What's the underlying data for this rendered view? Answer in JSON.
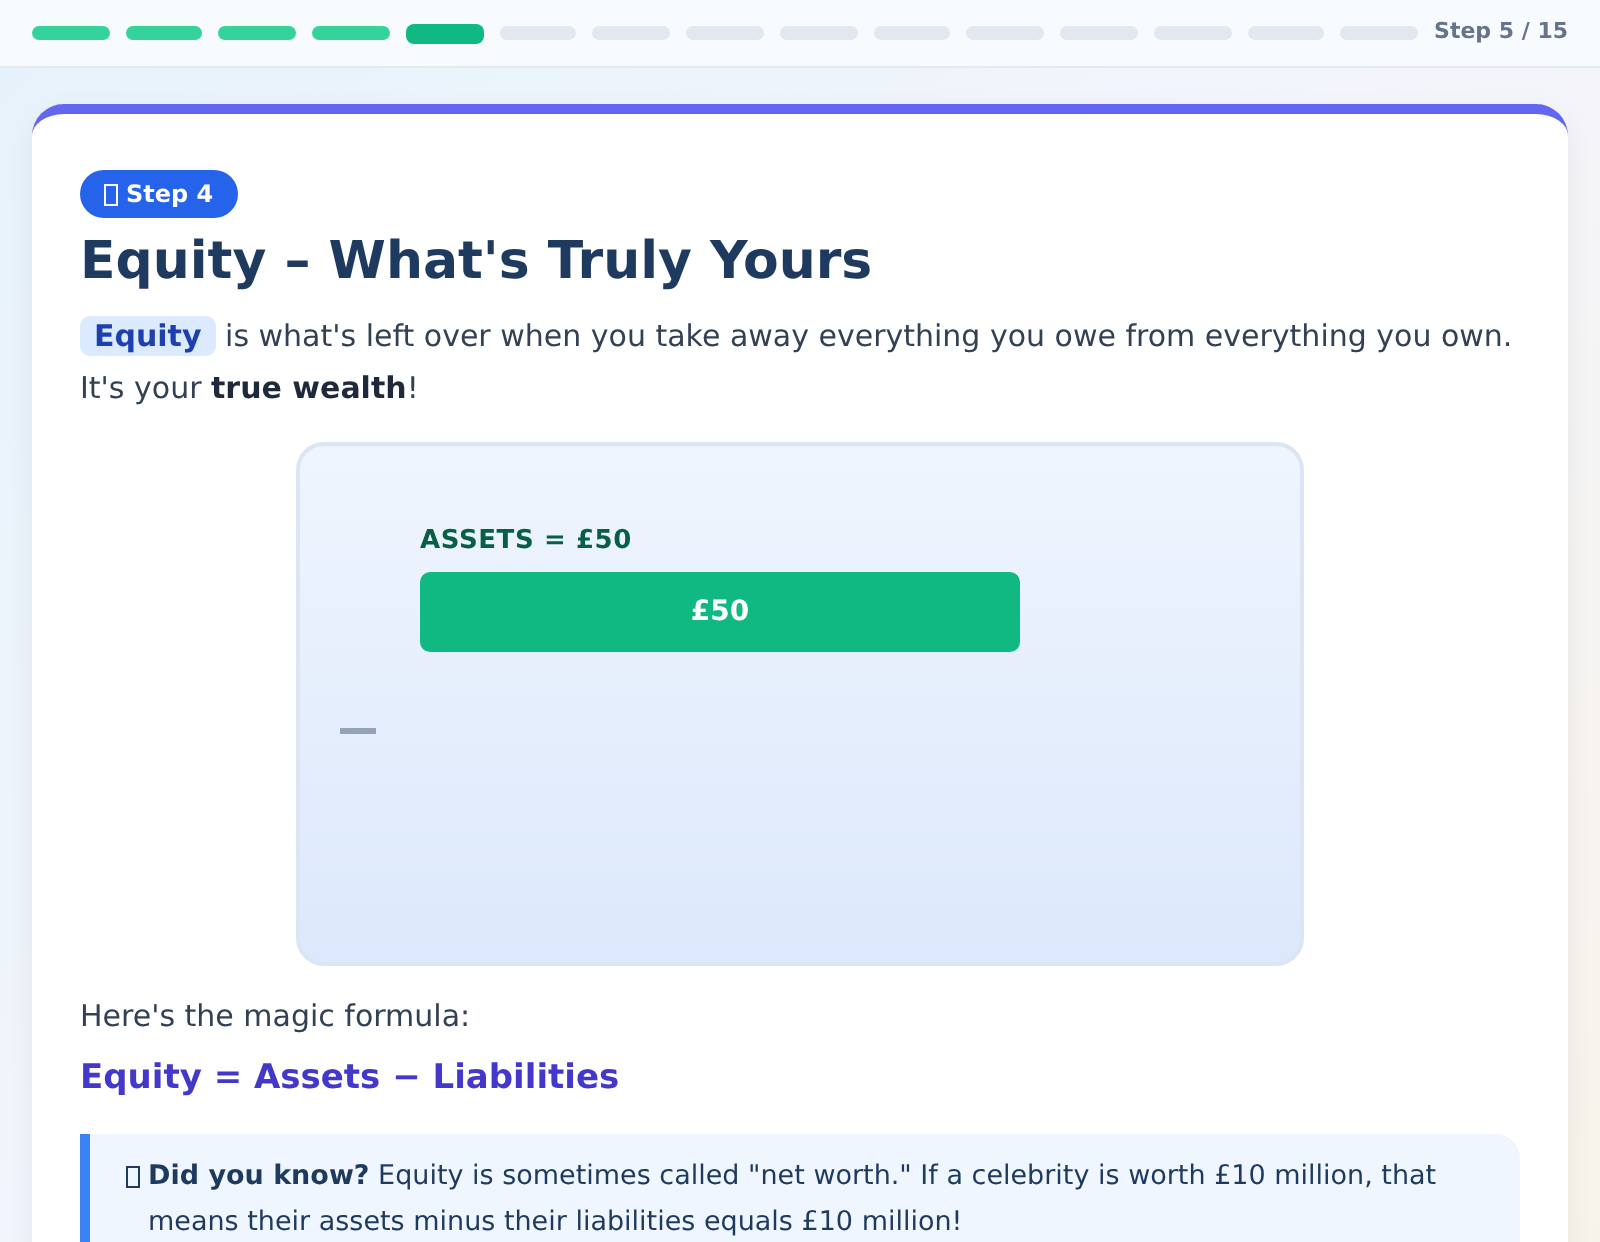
{
  "progress": {
    "segments": [
      {
        "done": true,
        "selected": false
      },
      {
        "done": true,
        "selected": false
      },
      {
        "done": true,
        "selected": false
      },
      {
        "done": true,
        "selected": false
      },
      {
        "done": false,
        "selected": true
      },
      {
        "done": false,
        "selected": false
      },
      {
        "done": false,
        "selected": false
      },
      {
        "done": false,
        "selected": false
      },
      {
        "done": false,
        "selected": false
      },
      {
        "done": false,
        "selected": false
      },
      {
        "done": false,
        "selected": false
      },
      {
        "done": false,
        "selected": false
      },
      {
        "done": false,
        "selected": false
      },
      {
        "done": false,
        "selected": false
      },
      {
        "done": false,
        "selected": false
      }
    ],
    "label": "Step 5 / 15"
  },
  "card": {
    "badge": "Step 4",
    "title": "Equity – What's Truly Yours",
    "intro": {
      "term": "Equity",
      "text": " is what's left over when you take away everything you owe from everything you own. It's your **true wealth**!"
    },
    "diagram": {
      "assets_label": "ASSETS = £50",
      "assets_bar": "£50"
    },
    "formula_intro": "Here's the magic formula:",
    "formula": "Equity = Assets − Liabilities",
    "tip": "**Did you know?** Equity is sometimes called \"net worth.\" If a celebrity is worth £10 million, that means their assets minus their liabilities equals £10 million!"
  }
}
